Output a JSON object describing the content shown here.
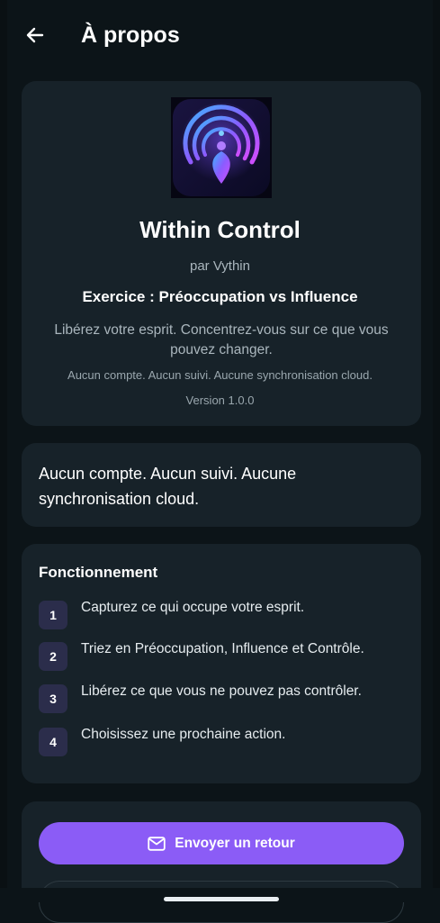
{
  "header": {
    "title": "À propos",
    "back_icon": "arrow-left-icon"
  },
  "about": {
    "logo_icon": "concentric-rings-logo-icon",
    "app_name": "Within Control",
    "author": "par Vythin",
    "exercise": "Exercice : Préoccupation vs Influence",
    "tagline": "Libérez votre esprit. Concentrez-vous sur ce que vous pouvez changer.",
    "privacy_note": "Aucun compte. Aucun suivi. Aucune synchronisation cloud.",
    "version": "Version 1.0.0"
  },
  "privacy": {
    "text": "Aucun compte. Aucun suivi. Aucune synchronisation cloud."
  },
  "how": {
    "title": "Fonctionnement",
    "steps": [
      {
        "num": "1",
        "text": "Capturez ce qui occupe votre esprit."
      },
      {
        "num": "2",
        "text": "Triez en Préoccupation, Influence et Contrôle."
      },
      {
        "num": "3",
        "text": "Libérez ce que vous ne pouvez pas contrôler."
      },
      {
        "num": "4",
        "text": "Choisissez une prochaine action."
      }
    ]
  },
  "actions": {
    "feedback_label": "Envoyer un retour",
    "feedback_icon": "mail-icon"
  },
  "colors": {
    "background": "#0c1418",
    "card": "#172229",
    "accent": "#8b5cf6",
    "step_badge": "#2b2d4b"
  }
}
